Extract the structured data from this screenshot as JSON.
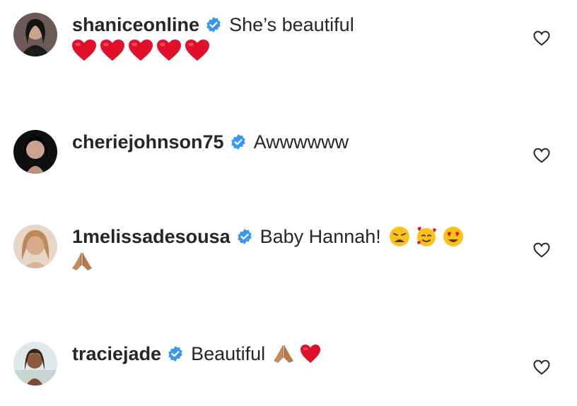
{
  "comments": [
    {
      "username": "shaniceonline",
      "verified": true,
      "text": "She’s beautiful",
      "line2_emojis": [
        "red-heart",
        "red-heart",
        "red-heart",
        "red-heart",
        "red-heart"
      ]
    },
    {
      "username": "cheriejohnson75",
      "verified": true,
      "text": "Awwwwww"
    },
    {
      "username": "1melissadesousa",
      "verified": true,
      "text": "Baby Hannah!",
      "inline_emojis": [
        "weary-face",
        "smiling-face-with-hearts",
        "heart-eyes-face"
      ],
      "line2_emojis": [
        "folded-hands"
      ]
    },
    {
      "username": "traciejade",
      "verified": true,
      "text": "Beautiful",
      "inline_emojis": [
        "folded-hands",
        "red-heart"
      ]
    }
  ],
  "icons": {
    "verified": "verified-badge-icon",
    "like": "heart-outline-icon"
  },
  "colors": {
    "verified_blue": "#3897f0",
    "text": "#262626",
    "heart_red": "#e0102a"
  }
}
